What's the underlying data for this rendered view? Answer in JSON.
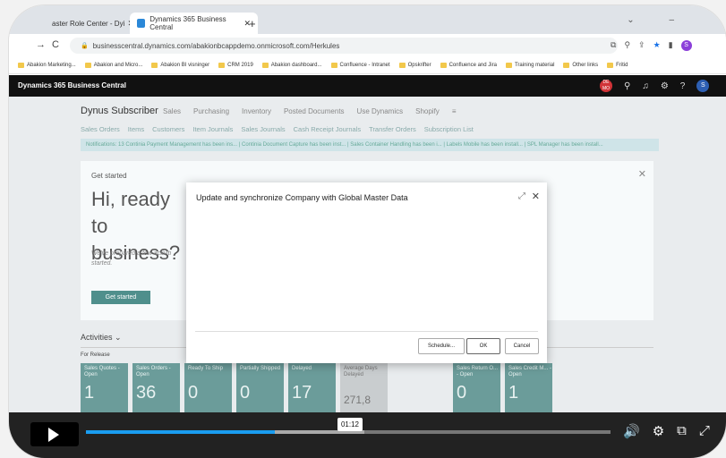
{
  "browser": {
    "tabs": [
      {
        "label": "aster Role Center - Dyi",
        "active": false
      },
      {
        "label": "Dynamics 365 Business Central",
        "active": true
      }
    ],
    "url": "businesscentral.dynamics.com/abakionbcappdemo.onmicrosoft.com/Herkules",
    "profile_initial": "S",
    "bookmarks": [
      "Abakion Marketing...",
      "Abakion and Micro...",
      "Abakion BI visninger",
      "CRM 2019",
      "Abakion dashboard...",
      "Confluence - Intranet",
      "Opskrifter",
      "Confluence and Jira",
      "Training material",
      "Other links",
      "Fritid"
    ]
  },
  "app": {
    "title": "Dynamics 365 Business Central",
    "badge_text": "DE MO",
    "user_initial": "S",
    "company": "Dynus Subscriber",
    "top_nav": [
      "Sales",
      "Purchasing",
      "Inventory",
      "Posted Documents",
      "Use Dynamics",
      "Shopify"
    ],
    "sub_nav": [
      "Sales Orders",
      "Items",
      "Customers",
      "Item Journals",
      "Sales Journals",
      "Cash Receipt Journals",
      "Transfer Orders",
      "Subscription List"
    ],
    "notifications": "Notifications: 13   Continia Payment Management has been ins... | Continia Document Capture has been inst... | Sales Container Handling has been i... | Labels Mobile has been install... | SPL Manager has been install...",
    "hero": {
      "heading": "Get started",
      "big_text": "Hi, ready to business?",
      "desc": "We've prepared a few activiti started.",
      "button": "Get started"
    },
    "activities_label": "Activities",
    "for_release_label": "For Release",
    "tiles": [
      {
        "label": "Sales Quotes - Open",
        "value": "1"
      },
      {
        "label": "Sales Orders - Open",
        "value": "36"
      },
      {
        "label": "Ready To Ship",
        "value": "0"
      },
      {
        "label": "Partially Shipped",
        "value": "0"
      },
      {
        "label": "Delayed",
        "value": "17"
      },
      {
        "label": "Average Days Delayed",
        "value": "271,8"
      },
      {
        "label": "Sales Return O... - Open",
        "value": "0"
      },
      {
        "label": "Sales Credit M... - Open",
        "value": "1"
      }
    ]
  },
  "modal": {
    "title": "Update and synchronize Company with Global Master Data",
    "buttons": {
      "schedule": "Schedule...",
      "ok": "OK",
      "cancel": "Cancel"
    }
  },
  "player": {
    "time": "01:12",
    "progress": 0.36,
    "buffered": 0.53
  }
}
